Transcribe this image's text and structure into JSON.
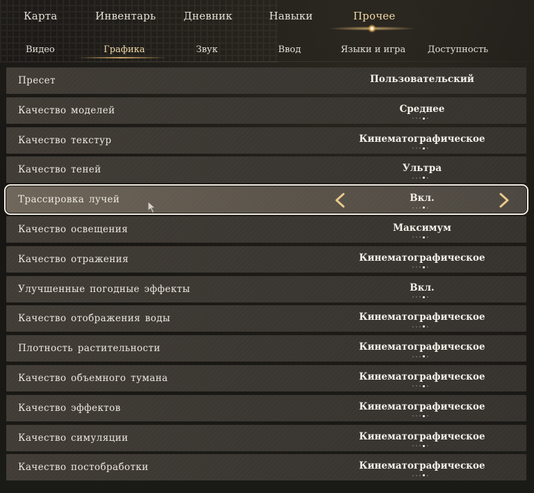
{
  "top_tabs": [
    {
      "label": "Карта"
    },
    {
      "label": "Инвентарь"
    },
    {
      "label": "Дневник"
    },
    {
      "label": "Навыки"
    },
    {
      "label": "Прочее"
    }
  ],
  "sub_tabs": [
    {
      "label": "Видео"
    },
    {
      "label": "Графика"
    },
    {
      "label": "Звук"
    },
    {
      "label": "Ввод"
    },
    {
      "label": "Языки и игра"
    },
    {
      "label": "Доступность"
    }
  ],
  "active_top_tab": "Прочее",
  "active_sub_tab": "Графика",
  "settings": [
    {
      "label": "Пресет",
      "value": "Пользовательский"
    },
    {
      "label": "Качество моделей",
      "value": "Среднее"
    },
    {
      "label": "Качество текстур",
      "value": "Кинематографическое"
    },
    {
      "label": "Качество теней",
      "value": "Ультра"
    },
    {
      "label": "Трассировка лучей",
      "value": "Вкл."
    },
    {
      "label": "Качество освещения",
      "value": "Максимум"
    },
    {
      "label": "Качество отражения",
      "value": "Кинематографическое"
    },
    {
      "label": "Улучшенные погодные эффекты",
      "value": "Вкл."
    },
    {
      "label": "Качество отображения воды",
      "value": "Кинематографическое"
    },
    {
      "label": "Плотность растительности",
      "value": "Кинематографическое"
    },
    {
      "label": "Качество объемного тумана",
      "value": "Кинематографическое"
    },
    {
      "label": "Качество эффектов",
      "value": "Кинематографическое"
    },
    {
      "label": "Качество симуляции",
      "value": "Кинематографическое"
    },
    {
      "label": "Качество постобработки",
      "value": "Кинематографическое"
    }
  ],
  "selected_setting": "Трассировка лучей",
  "icons": {
    "arrow_left": "chevron-left-icon",
    "arrow_right": "chevron-right-icon",
    "cursor": "mouse-cursor-icon"
  },
  "colors": {
    "accent": "#f0d9a8",
    "arrow": "#e8c98a",
    "selection_outline": "#f3efe6"
  }
}
